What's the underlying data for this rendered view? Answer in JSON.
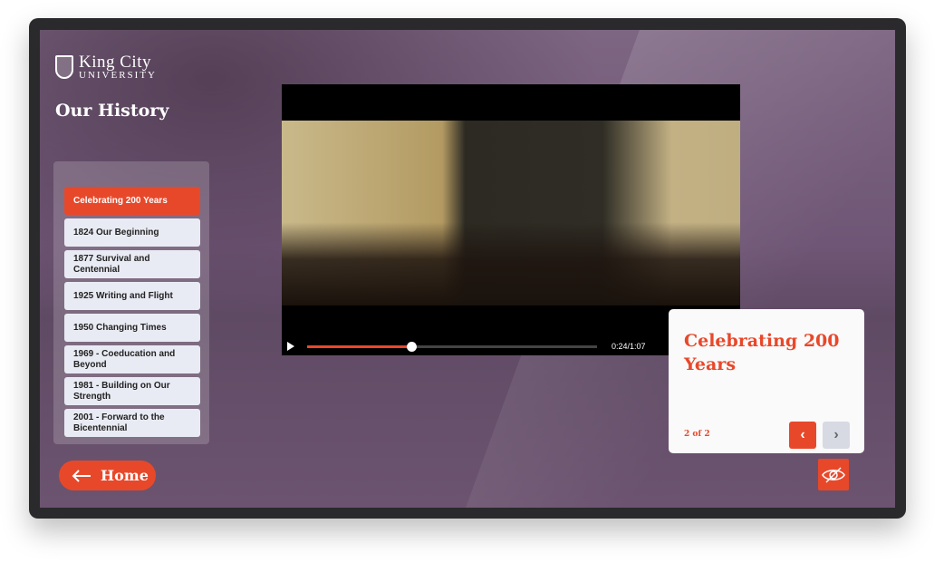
{
  "brand": {
    "name_line1": "King City",
    "name_line2": "University"
  },
  "page_title": "Our History",
  "menu": [
    {
      "label": "Celebrating 200 Years",
      "active": true
    },
    {
      "label": "1824 Our Beginning"
    },
    {
      "label": "1877 Survival and Centennial"
    },
    {
      "label": "1925 Writing and Flight"
    },
    {
      "label": "1950 Changing Times"
    },
    {
      "label": "1969 - Coeducation and Beyond"
    },
    {
      "label": "1981 - Building on Our Strength"
    },
    {
      "label": "2001 - Forward to the Bicentennial"
    }
  ],
  "video": {
    "time": "0:24/1:07",
    "progress": 0.36
  },
  "card": {
    "title": "Celebrating 200 Years",
    "counter": "2 of 2",
    "prev_icon": "chevron-left",
    "next_icon": "chevron-right"
  },
  "home": {
    "label": "Home",
    "icon": "arrow-left"
  },
  "hide_button": {
    "icon": "eye-slash"
  },
  "colors": {
    "accent": "#e8482a",
    "overlay": "#6f5676"
  }
}
